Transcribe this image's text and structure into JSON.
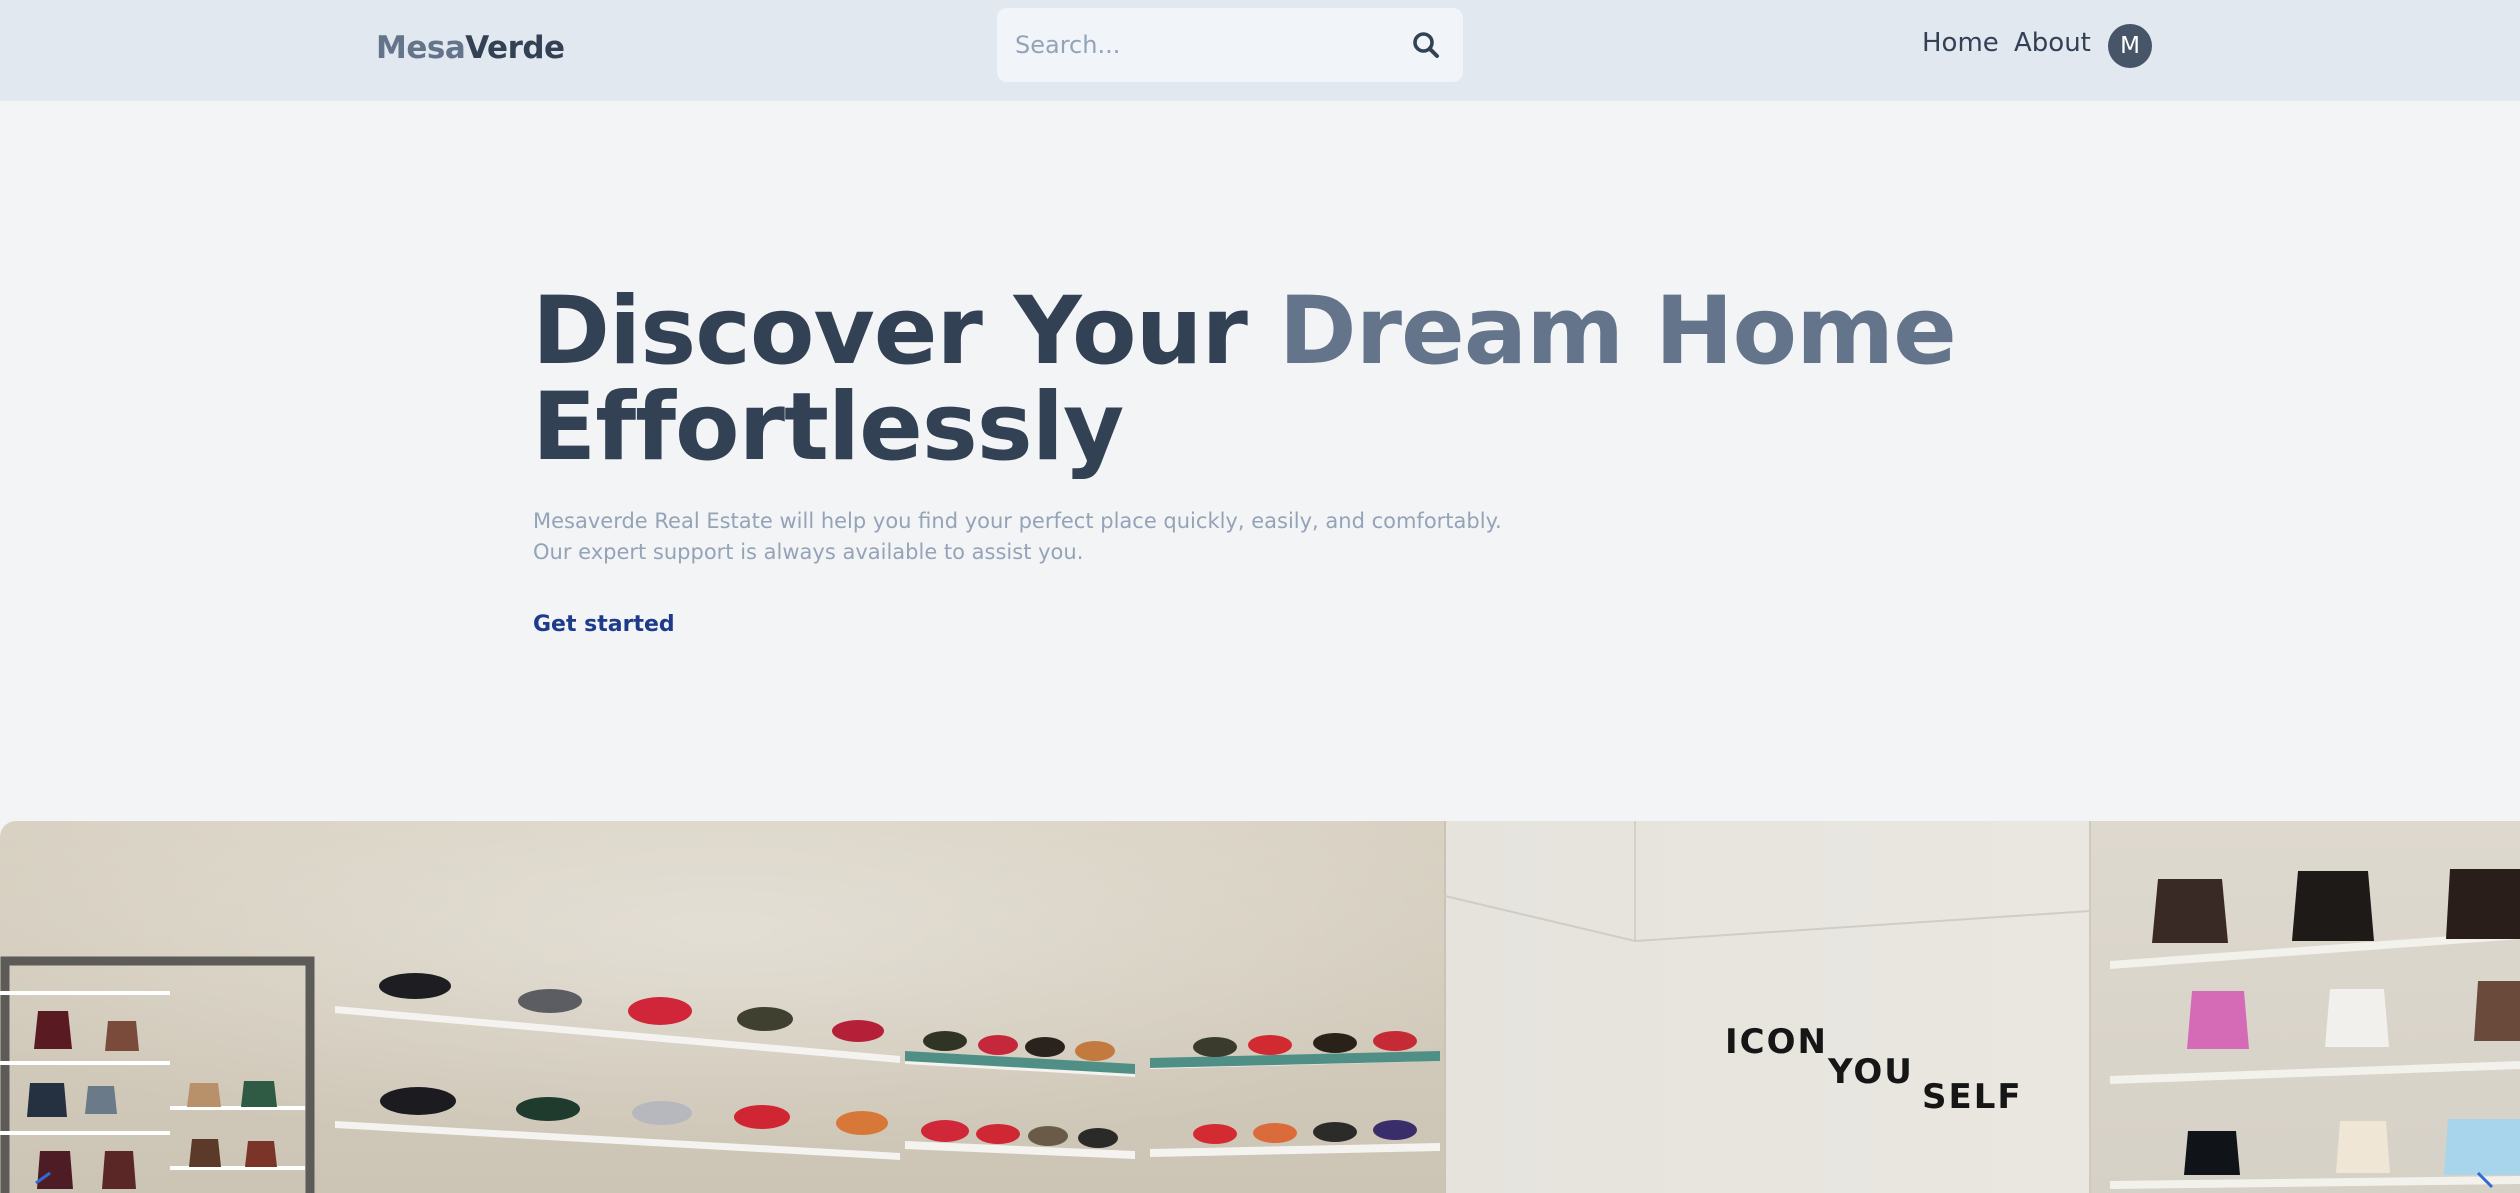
{
  "brand": {
    "part1": "Mesa",
    "part2": "Verde"
  },
  "search": {
    "placeholder": "Search...",
    "value": ""
  },
  "nav": {
    "home": "Home",
    "about": "About"
  },
  "user": {
    "avatar_initial": "M"
  },
  "hero": {
    "title_part1": "Discover Your ",
    "title_accent": "Dream Home",
    "title_part2": "Effortlessly",
    "description_line1": "Mesaverde Real Estate will help you find your perfect place quickly, easily, and comfortably.",
    "description_line2": "Our expert support is always available to assist you.",
    "cta": "Get started"
  },
  "store_image": {
    "wall_text_1": "ICON",
    "wall_text_2": "YOU",
    "wall_text_3": "SELF"
  },
  "colors": {
    "nav_bg": "#e2e8f0",
    "page_bg": "#f3f4f6",
    "accent": "#64748b",
    "heading": "#334155",
    "cta": "#1e3a8a"
  }
}
